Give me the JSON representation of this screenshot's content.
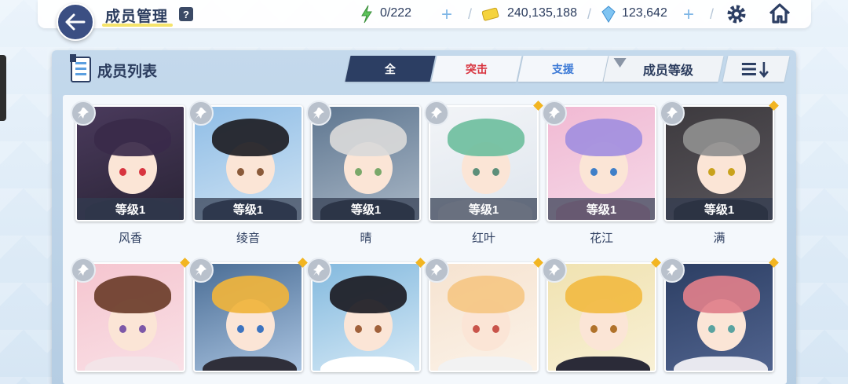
{
  "header": {
    "title": "成员管理",
    "help_label": "?",
    "stamina": "0/222",
    "credits": "240,135,188",
    "gems": "123,642",
    "plus_label": "+",
    "separator": "/"
  },
  "panel": {
    "title": "成员列表",
    "tabs": [
      {
        "label": "全"
      },
      {
        "label": "突击"
      },
      {
        "label": "支援"
      }
    ],
    "sort_label": "成员等级"
  },
  "colors": {
    "accent_dark": "#2c3e63",
    "tab_red": "#d8343f",
    "tab_blue": "#3b79d6",
    "badge_gold": "#f2b521"
  },
  "members": [
    {
      "name": "风香",
      "level": "等级1"
    },
    {
      "name": "绫音",
      "level": "等级1"
    },
    {
      "name": "晴",
      "level": "等级1"
    },
    {
      "name": "红叶",
      "level": "等级1"
    },
    {
      "name": "花江",
      "level": "等级1"
    },
    {
      "name": "满",
      "level": "等级1"
    },
    {
      "name": "",
      "level": ""
    },
    {
      "name": "",
      "level": ""
    },
    {
      "name": "",
      "level": ""
    },
    {
      "name": "",
      "level": ""
    },
    {
      "name": "",
      "level": ""
    },
    {
      "name": "",
      "level": ""
    }
  ]
}
